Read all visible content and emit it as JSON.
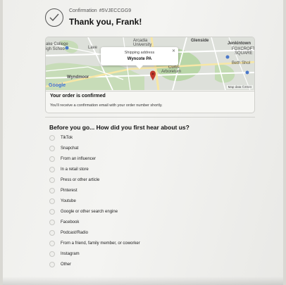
{
  "header": {
    "confirmation_label": "Confirmation",
    "confirmation_number": "#5VJECCGG9",
    "thanks": "Thank you, Frank!"
  },
  "map": {
    "popup_label": "Shipping address",
    "popup_value": "Wyncote PA",
    "places": {
      "arcadia": "Arcadia",
      "university": "University",
      "glenside": "Glenside",
      "college": "ake College",
      "school": "igh Schoo",
      "lave": "Lave",
      "jenkintown": "Jenkintown",
      "foxcroft": "FOXCROFT",
      "square": "SQUARE",
      "beth_sholom": "Beth Shol",
      "arboretum": "Arboretum",
      "curtis": "Curtis",
      "wyndmoor": "Wyndmoor"
    },
    "logo": "Google",
    "attribution": "Map data ©2024"
  },
  "order": {
    "title": "Your order is confirmed",
    "text": "You'll receive a confirmation email with your order number shortly."
  },
  "survey": {
    "title": "Before you go... How did you first hear about us?",
    "options": [
      "TikTok",
      "Snapchat",
      "From an influencer",
      "In a retail store",
      "Press or other article",
      "Pinterest",
      "Youtube",
      "Google or other search engine",
      "Facebook",
      "Podcast/Radio",
      "From a friend, family member, or coworker",
      "Instagram",
      "Other"
    ]
  },
  "colors": {
    "map_green": "#b9d6a8",
    "map_road": "#f7e7a6",
    "pin": "#c0392b",
    "google_blue": "#3b6fd6"
  }
}
